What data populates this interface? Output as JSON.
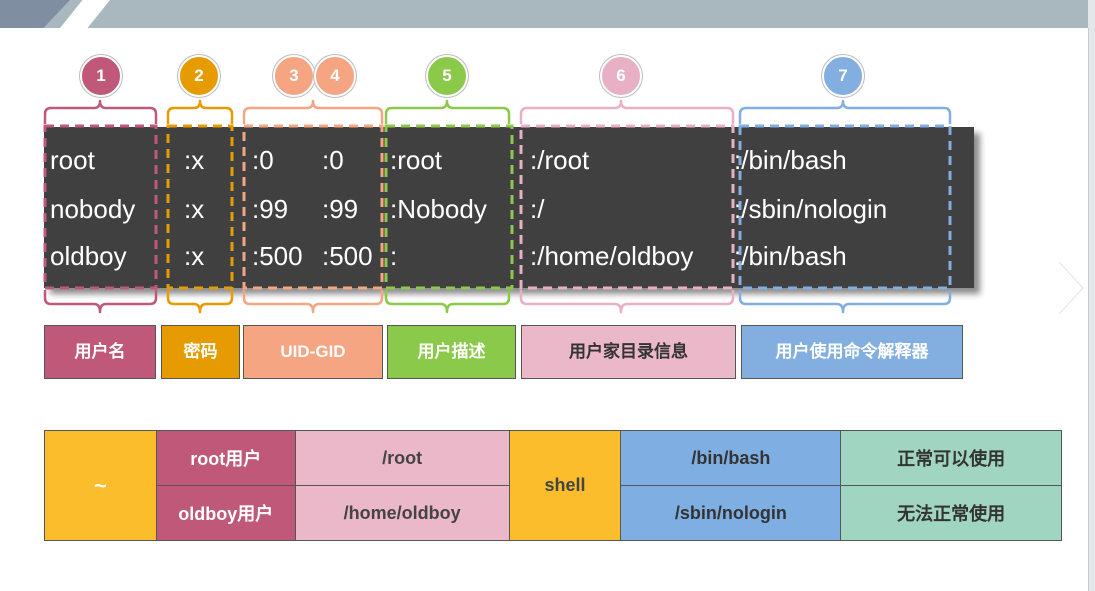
{
  "colors": {
    "field1": "#c0587a",
    "field2": "#e69b00",
    "field34": "#f5a582",
    "field5": "#8bc94a",
    "field6": "#e8b0c4",
    "field7": "#82aee0",
    "terminal_bg": "#404040",
    "summary_tilde_bg": "#fbbd2b",
    "summary_users_bg": "#c0587a",
    "summary_home_bg": "#eab8c9",
    "summary_shell_bg": "#fbbd2b",
    "summary_path_bg": "#7fafe2",
    "summary_desc_bg": "#9fd5c1"
  },
  "markers": [
    "1",
    "2",
    "3",
    "4",
    "5",
    "6",
    "7"
  ],
  "terminal": {
    "rows": [
      {
        "user": "root",
        "pw": ":x",
        "uid": ":0",
        "gid": ":0",
        "desc": ":root",
        "home": ":/root",
        "shell": ":/bin/bash"
      },
      {
        "user": "nobody",
        "pw": ":x",
        "uid": ":99",
        "gid": ":99",
        "desc": ":Nobody",
        "home": ":/",
        "shell": ":/sbin/nologin"
      },
      {
        "user": "oldboy",
        "pw": ":x",
        "uid": ":500",
        "gid": ":500",
        "desc": ":",
        "home": ":/home/oldboy",
        "shell": ":/bin/bash"
      }
    ]
  },
  "labels": {
    "username": "用户名",
    "password": "密码",
    "uid_gid": "UID-GID",
    "description": "用户描述",
    "home": "用户家目录信息",
    "shell": "用户使用命令解释器"
  },
  "summary": {
    "tilde": "~",
    "root_user": "root用户",
    "root_home": "/root",
    "oldboy_user": "oldboy用户",
    "oldboy_home": "/home/oldboy",
    "shell_label": "shell",
    "bash": "/bin/bash",
    "bash_desc": "正常可以使用",
    "nologin": "/sbin/nologin",
    "nologin_desc": "无法正常使用"
  },
  "icons": {
    "next": "chevron-right-icon"
  }
}
